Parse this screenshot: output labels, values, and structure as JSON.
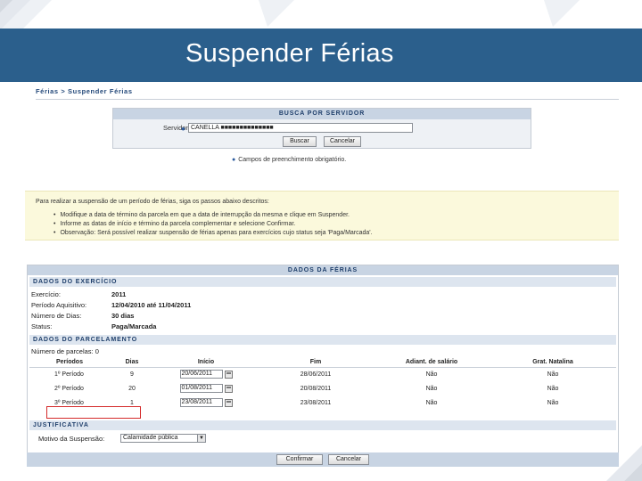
{
  "slide_title": "Suspender Férias",
  "breadcrumb": "Férias > Suspender Férias",
  "search": {
    "caption": "Busca por Servidor",
    "servidor_label": "Servidor:",
    "servidor_value": "CANELLA ■■■■■■■■■■■■■■",
    "buscar_label": "Buscar",
    "cancelar_label": "Cancelar"
  },
  "legend": "Campos de preenchimento obrigatório.",
  "notice": {
    "lead": "Para realizar a suspensão de um período de férias, siga os passos abaixo descritos:",
    "items": [
      "Modifique a data de término da parcela em que a data de interrupção da mesma e clique em Suspender.",
      "Informe as datas de início e término da parcela complementar e selecione Confirmar.",
      "Observação: Será possível realizar suspensão de férias apenas para exercícios cujo status seja 'Paga/Marcada'."
    ]
  },
  "ferias": {
    "caption": "Dados da Férias",
    "exercicio_caption": "Dados do Exercício",
    "exercicio": [
      {
        "label": "Exercício:",
        "value": "2011"
      },
      {
        "label": "Período Aquisitivo:",
        "value": "12/04/2010 até 11/04/2011"
      },
      {
        "label": "Número de Dias:",
        "value": "30 dias"
      },
      {
        "label": "Status:",
        "value": "Paga/Marcada"
      }
    ],
    "parcelamento_caption": "Dados do Parcelamento",
    "parcelas_label": "Número de parcelas:",
    "parcelas_value": "0",
    "columns": [
      "Períodos",
      "Dias",
      "Início",
      "Fim",
      "Adiant. de salário",
      "Grat. Natalina"
    ],
    "rows": [
      {
        "periodo": "1º Período",
        "dias": "9",
        "inicio": "20/06/2011",
        "fim": "28/06/2011",
        "adiant": "Não",
        "grat": "Não"
      },
      {
        "periodo": "2º Período",
        "dias": "20",
        "inicio": "01/08/2011",
        "fim": "20/08/2011",
        "adiant": "Não",
        "grat": "Não"
      },
      {
        "periodo": "3º Período",
        "dias": "1",
        "inicio": "23/08/2011",
        "fim": "23/08/2011",
        "adiant": "Não",
        "grat": "Não"
      }
    ],
    "justificativa_caption": "Justificativa",
    "motivo_label": "Motivo da Suspensão:",
    "motivo_value": "Calamidade pública"
  },
  "footer": {
    "confirmar_label": "Confirmar",
    "cancelar_label": "Cancelar"
  },
  "colors": {
    "banner": "#2b5f8c",
    "caption_bg": "#c8d4e3",
    "notice_bg": "#fbf9dc",
    "highlight_border": "#d42a2a"
  }
}
